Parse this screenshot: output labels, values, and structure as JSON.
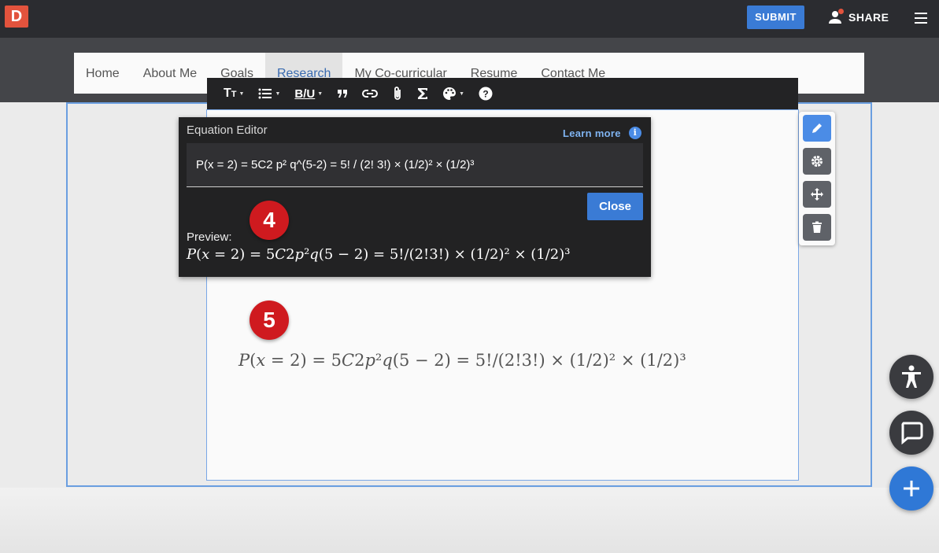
{
  "app": {
    "logo_letter": "D"
  },
  "topbar": {
    "submit_label": "SUBMIT",
    "share_label": "SHARE"
  },
  "nav": {
    "items": [
      {
        "label": "Home"
      },
      {
        "label": "About Me"
      },
      {
        "label": "Goals"
      },
      {
        "label": "Research",
        "active": true
      },
      {
        "label": "My Co-curricular"
      },
      {
        "label": "Resume"
      },
      {
        "label": "Contact Me"
      }
    ]
  },
  "toolbar": {
    "items": [
      "text-size-icon",
      "list-icon",
      "bold-italic-underline-icon",
      "quote-icon",
      "link-icon",
      "attachment-icon",
      "sigma-icon",
      "palette-icon",
      "help-icon"
    ],
    "biu_label": "B/U"
  },
  "side_controls": [
    "pencil-icon",
    "gear-icon",
    "move-icon",
    "trash-icon"
  ],
  "equation_editor": {
    "title": "Equation Editor",
    "learn_more": "Learn more",
    "input_value": "P(x = 2) = 5C2 p² q^(5-2) = 5! / (2! 3!) × (1/2)² × (1/2)³",
    "close_label": "Close",
    "preview_label": "Preview:"
  },
  "markers": {
    "first": "4",
    "second": "5"
  },
  "colors": {
    "accent": "#3a7bd5",
    "logo": "#e2533d",
    "marker": "#cf1a1f",
    "toolbar": "#232325"
  },
  "fabs": [
    "accessibility-icon",
    "chat-icon",
    "plus-icon"
  ]
}
